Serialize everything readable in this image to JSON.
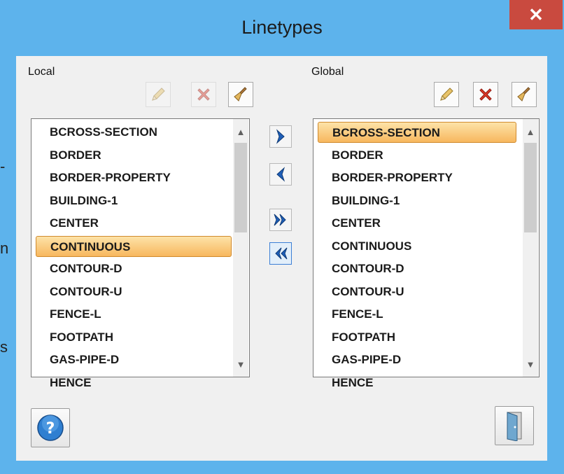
{
  "background_text": [
    "-",
    "n",
    "s"
  ],
  "window": {
    "title": "Linetypes",
    "close_glyph": "✕",
    "titlebar_color": "#5db3ec",
    "close_color": "#c94a3f"
  },
  "local": {
    "label": "Local",
    "toolbar": [
      {
        "icon": "pencil-icon",
        "tooltip": "",
        "enabled": false
      },
      {
        "icon": "delete-x-icon",
        "enabled": false
      },
      {
        "icon": "broom-icon",
        "enabled": true
      }
    ],
    "items": [
      "BCROSS-SECTION",
      "BORDER",
      "BORDER-PROPERTY",
      "BUILDING-1",
      "CENTER",
      "CONTINUOUS",
      "CONTOUR-D",
      "CONTOUR-U",
      "FENCE-L",
      "FOOTPATH",
      "GAS-PIPE-D",
      "HENCE"
    ],
    "selected_index": 5
  },
  "global": {
    "label": "Global",
    "toolbar": [
      {
        "icon": "pencil-icon",
        "enabled": true
      },
      {
        "icon": "delete-x-icon",
        "enabled": true
      },
      {
        "icon": "broom-icon",
        "enabled": true
      }
    ],
    "items": [
      "BCROSS-SECTION",
      "BORDER",
      "BORDER-PROPERTY",
      "BUILDING-1",
      "CENTER",
      "CONTINUOUS",
      "CONTOUR-D",
      "CONTOUR-U",
      "FENCE-L",
      "FOOTPATH",
      "GAS-PIPE-D",
      "HENCE"
    ],
    "selected_index": 0
  },
  "transfer": [
    {
      "icon": "arrow-right-icon"
    },
    {
      "icon": "arrow-left-icon"
    },
    {
      "icon": "double-arrow-right-icon"
    },
    {
      "icon": "double-arrow-left-icon",
      "focused": true
    }
  ],
  "footer": {
    "help_icon": "help-icon",
    "exit_icon": "exit-door-icon"
  },
  "colors": {
    "selection_top": "#fde3a8",
    "selection_bottom": "#f7b75e",
    "arrow_blue": "#1f5fb8"
  }
}
